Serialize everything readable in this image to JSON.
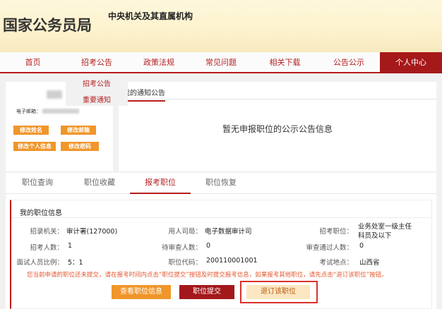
{
  "header": {
    "title": "国家公务员局",
    "subtitle": "中央机关及其直属机构"
  },
  "nav": {
    "items": [
      "首页",
      "招考公告",
      "政策法规",
      "常见问题",
      "相关下载",
      "公告公示",
      "个人中心"
    ]
  },
  "dropdown": {
    "items": [
      "招考公告",
      "重要通知"
    ]
  },
  "profile": {
    "email_label": "电子邮箱：",
    "buttons": [
      "修改姓名",
      "修改邮箱",
      "修改个人信息",
      "修改密码"
    ]
  },
  "notices": {
    "tab_label": "我的通知公告",
    "empty_text": "暂无申报职位的公示公告信息"
  },
  "position_tabs": [
    "职位查询",
    "职位收藏",
    "报考职位",
    "职位恢复"
  ],
  "my_position": {
    "title": "我的职位信息",
    "fields": {
      "agency_label": "招录机关：",
      "agency_value": "审计署(127000)",
      "employer_label": "用人司局：",
      "employer_value": "电子数据审计司",
      "job_label": "招考职位：",
      "job_value_line1": "业务处室一级主任",
      "job_value_line2": "科员及以下",
      "headcount_label": "招考人数：",
      "headcount_value": "1",
      "pending_label": "待审查人数：",
      "pending_value": "0",
      "passed_label": "审查通过人数：",
      "passed_value": "0",
      "ratio_label": "面试人员比例：",
      "ratio_value": "5：1",
      "code_label": "职位代码：",
      "code_value": "200110001001",
      "location_label": "考试地点：",
      "location_value": "山西省"
    },
    "notice": "您当前申请的职位还未提交，请在报考时间内点击“职位提交”按钮及时提交报考信息，如果报考其他职位，请先点击“退订该职位”按钮。",
    "buttons": {
      "view": "查看职位信息",
      "submit": "职位提交",
      "cancel": "退订该职位"
    }
  },
  "colors": {
    "brand_red": "#a6191a",
    "accent_orange": "#f0962b",
    "notice_orange": "#e4572e"
  }
}
